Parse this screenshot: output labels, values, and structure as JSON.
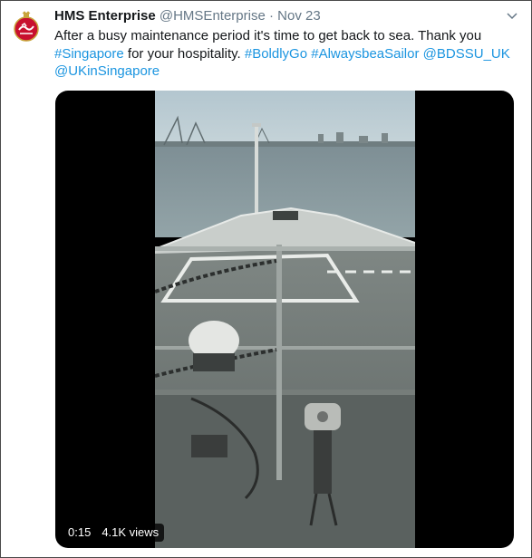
{
  "tweet": {
    "display_name": "HMS Enterprise",
    "handle": "@HMSEnterprise",
    "separator": "·",
    "date": "Nov 23",
    "text_line1": "After a busy maintenance period it's time to get back to sea. Thank you",
    "hashtag_singapore": "#Singapore",
    "text_mid": " for your hospitality. ",
    "hashtag_boldlygo": "#BoldlyGo",
    "hashtag_alwaysbeasailor": "#AlwaysbeaSailor",
    "mention_bdssu": "@BDSSU_UK",
    "mention_ukinsingapore": "@UKinSingapore",
    "video": {
      "duration": "0:15",
      "views": "4.1K views"
    }
  },
  "colors": {
    "link": "#1b95e0",
    "secondary_text": "#657786",
    "avatar_red": "#c8102e"
  }
}
